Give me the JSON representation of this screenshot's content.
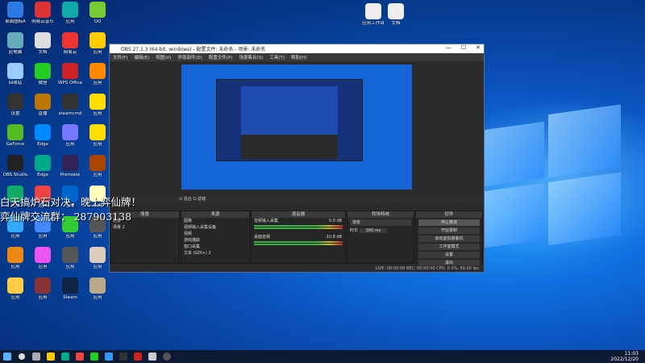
{
  "desktop_icons": [
    {
      "label": "桌面图标A",
      "color": "#2c7be5"
    },
    {
      "label": "网易云音乐",
      "color": "#d33"
    },
    {
      "label": "应用",
      "color": "#1aa"
    },
    {
      "label": "QQ",
      "color": "#7c3"
    },
    {
      "label": "此电脑",
      "color": "#6ab"
    },
    {
      "label": "文档",
      "color": "#ddd"
    },
    {
      "label": "网易云",
      "color": "#e33"
    },
    {
      "label": "应用",
      "color": "#fc0"
    },
    {
      "label": "回收站",
      "color": "#9cf"
    },
    {
      "label": "微信",
      "color": "#2c2"
    },
    {
      "label": "WPS Office",
      "color": "#c22"
    },
    {
      "label": "应用",
      "color": "#f80"
    },
    {
      "label": "设置",
      "color": "#333"
    },
    {
      "label": "直播",
      "color": "#b70"
    },
    {
      "label": "steamcmd",
      "color": "#333"
    },
    {
      "label": "应用",
      "color": "#fd0"
    },
    {
      "label": "GeForce",
      "color": "#5b2"
    },
    {
      "label": "Edge",
      "color": "#08f"
    },
    {
      "label": "应用",
      "color": "#77f"
    },
    {
      "label": "应用",
      "color": "#fd0"
    },
    {
      "label": "OBS Studio",
      "color": "#222"
    },
    {
      "label": "Edge",
      "color": "#0a8"
    },
    {
      "label": "Premiere",
      "color": "#325"
    },
    {
      "label": "应用",
      "color": "#a40"
    },
    {
      "label": "应用",
      "color": "#1a6"
    },
    {
      "label": "应用",
      "color": "#e44"
    },
    {
      "label": "应用",
      "color": "#06c"
    },
    {
      "label": "应用",
      "color": "#ffb"
    },
    {
      "label": "应用",
      "color": "#3af"
    },
    {
      "label": "应用",
      "color": "#48f"
    },
    {
      "label": "应用",
      "color": "#3c3"
    },
    {
      "label": "应用",
      "color": "#555"
    },
    {
      "label": "应用",
      "color": "#e81"
    },
    {
      "label": "应用",
      "color": "#e5e"
    },
    {
      "label": "应用",
      "color": "#555"
    },
    {
      "label": "应用",
      "color": "#dcb"
    },
    {
      "label": "应用",
      "color": "#fc4"
    },
    {
      "label": "应用",
      "color": "#833"
    },
    {
      "label": "Steam",
      "color": "#124"
    },
    {
      "label": "应用",
      "color": "#ba8"
    }
  ],
  "top_icons": [
    {
      "label": "应用工作台",
      "color": "#eee"
    },
    {
      "label": "文档",
      "color": "#eee"
    }
  ],
  "obs": {
    "title": "OBS 27.1.3 (64-bit, windows) - 配置文件: 未命名 - 场景: 未命名",
    "win_btns": [
      "—",
      "☐",
      "✕"
    ],
    "menu": [
      "文件(F)",
      "编辑(E)",
      "视图(V)",
      "停靠部件(D)",
      "配置文件(P)",
      "场景集合(S)",
      "工具(T)",
      "帮助(H)"
    ],
    "strip": "⊙ 混合 ⊡ 滤镜",
    "scenes": {
      "header": "场景",
      "items": [
        "场景",
        "场景 2"
      ]
    },
    "sources": {
      "header": "来源",
      "items": [
        "图像",
        "视频输入采集设备",
        "视频",
        "游戏捕获",
        "窗口采集",
        "文本 (GDI+) 2"
      ]
    },
    "mixer": {
      "header": "混音器",
      "ch1": "音频输入采集",
      "ch1_db": "0.0 dB",
      "ch2": "桌面音频",
      "ch2_db": "-10.8 dB"
    },
    "transitions": {
      "header": "转场特效",
      "type": "渐变",
      "duration_label": "时长",
      "duration": "300 ms"
    },
    "controls": {
      "header": "控件",
      "buttons": [
        "停止推流",
        "开始录制",
        "启动虚拟摄像机",
        "工作室模式",
        "设置",
        "退出"
      ]
    },
    "status": "LIVE: 00:00:00   REC: 00:00:00   CPU: 0.5%, 60.00 fps"
  },
  "overlay": {
    "line1": "白天搞炉石对决，晚上弈仙牌！",
    "line2": "弈仙牌交流群：  287903138"
  },
  "tray": {
    "time": "11:03",
    "date": "2022/12/20"
  }
}
